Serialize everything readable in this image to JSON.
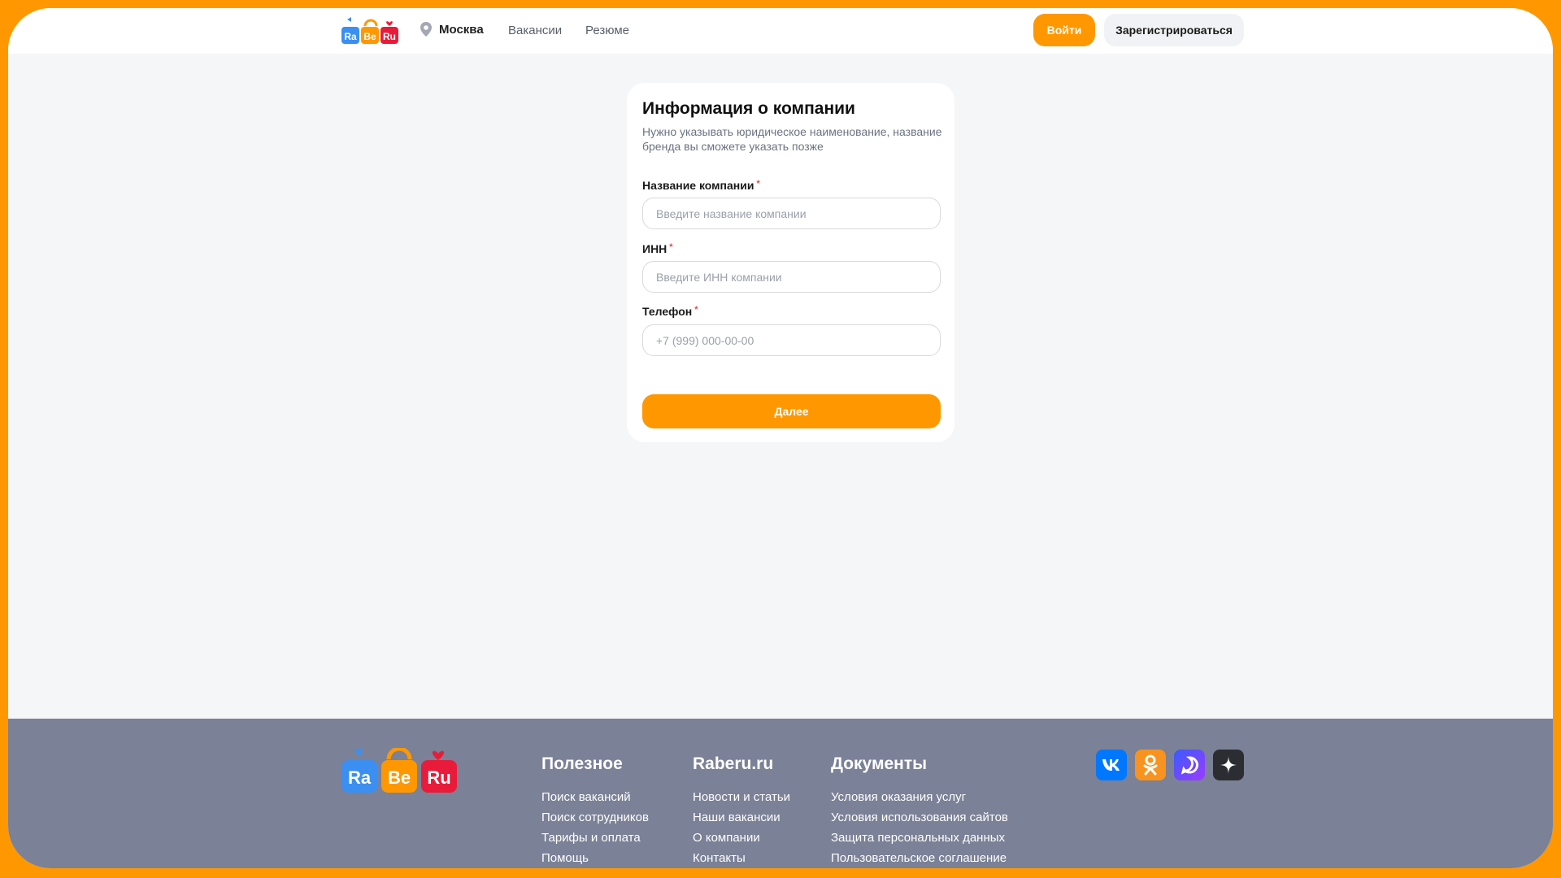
{
  "colors": {
    "accent": "#ff9800",
    "background": "#f5f6f8",
    "footer": "#7b8196",
    "logo_blue": "#3b8ff0",
    "logo_orange": "#ff9800",
    "logo_red": "#e81c3a"
  },
  "header": {
    "logo": [
      "Ra",
      "Be",
      "Ru"
    ],
    "city": "Москва",
    "nav": [
      "Вакансии",
      "Резюме"
    ],
    "login_label": "Войти",
    "register_label": "Зарегистрироваться",
    "location_icon": "map-pin-icon"
  },
  "form": {
    "title": "Информация о компании",
    "subtitle": "Нужно указывать юридическое наименование, название бренда вы сможете указать позже",
    "fields": [
      {
        "label": "Название компании",
        "required_mark": "*",
        "placeholder": "Введите название компании",
        "value": ""
      },
      {
        "label": "ИНН",
        "required_mark": "*",
        "placeholder": "Введите ИНН компании",
        "value": ""
      },
      {
        "label": "Телефон",
        "required_mark": "*",
        "placeholder": "+7 (999) 000-00-00",
        "value": ""
      }
    ],
    "submit_label": "Далее"
  },
  "footer": {
    "logo": [
      "Ra",
      "Be",
      "Ru"
    ],
    "columns": [
      {
        "title": "Полезное",
        "links": [
          "Поиск вакансий",
          "Поиск сотрудников",
          "Тарифы и оплата",
          "Помощь"
        ]
      },
      {
        "title": "Raberu.ru",
        "links": [
          "Новости и статьи",
          "Наши вакансии",
          "О компании",
          "Контакты"
        ]
      },
      {
        "title": "Документы",
        "links": [
          "Условия оказания услуг",
          "Условия использования сайтов",
          "Защита персональных данных",
          "Пользовательское соглашение"
        ]
      }
    ],
    "socials": [
      "vk-icon",
      "odnoklassniki-icon",
      "max-messenger-icon",
      "dzen-icon"
    ]
  }
}
